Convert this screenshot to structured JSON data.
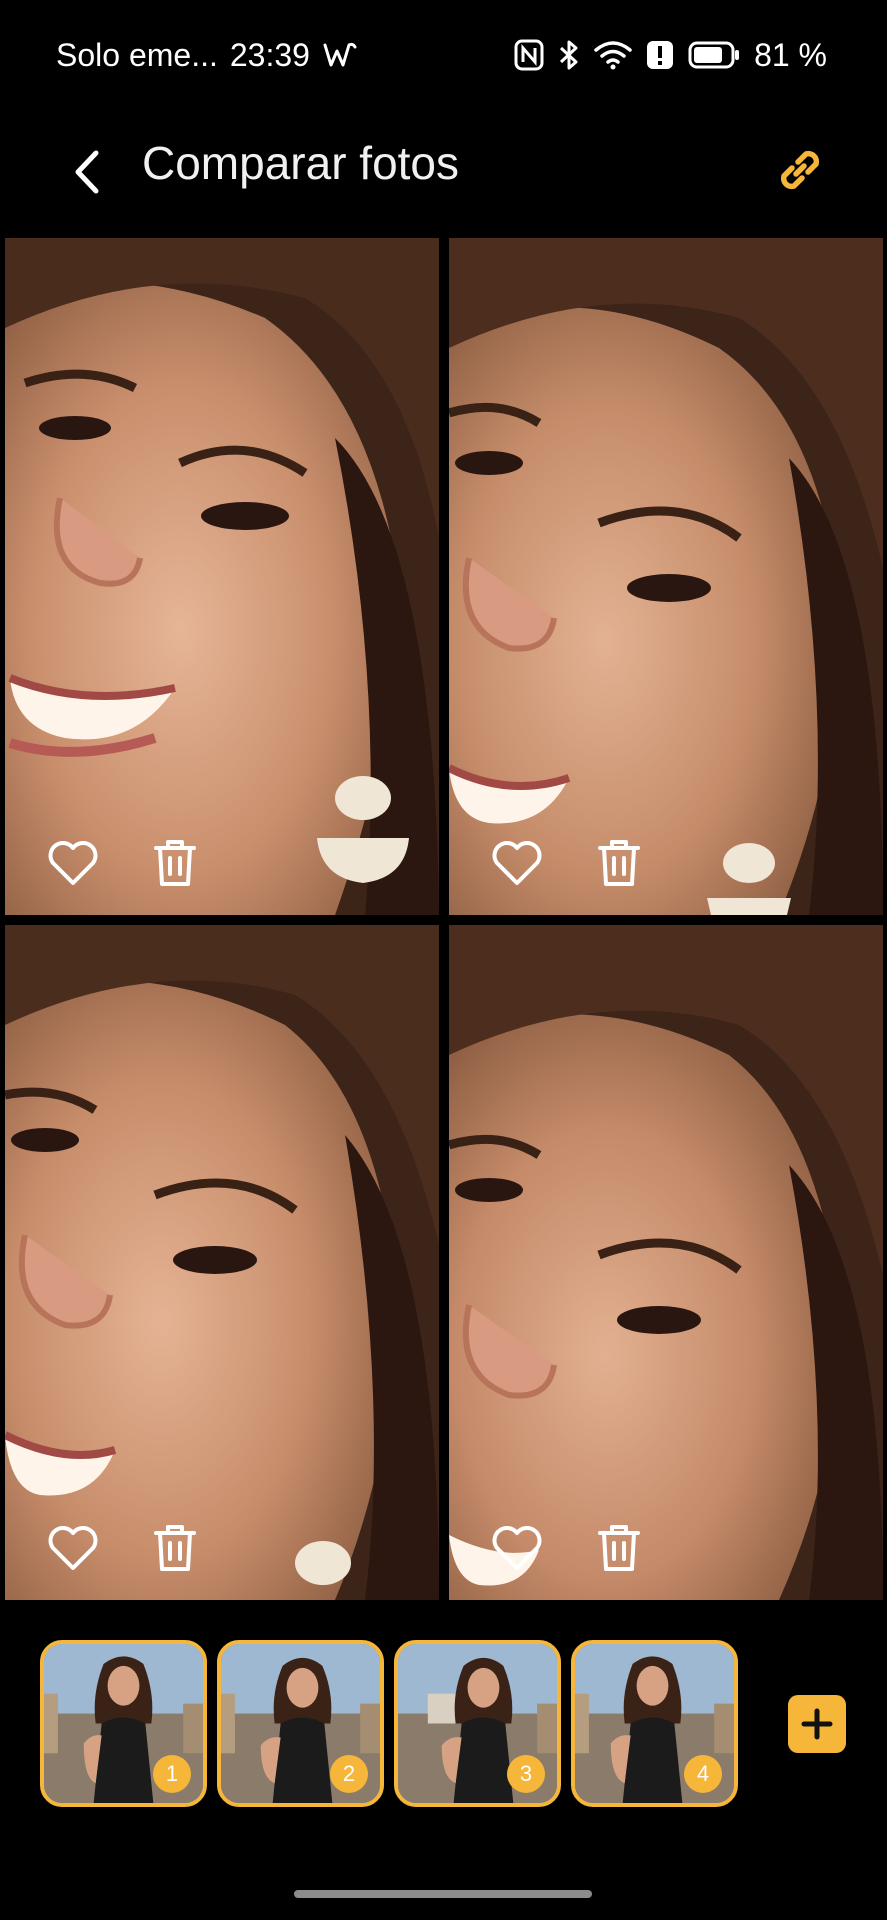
{
  "status_bar": {
    "carrier": "Solo eme...",
    "time": "23:39",
    "battery": "81 %",
    "icons": [
      "signal-wave-icon",
      "nfc-icon",
      "bluetooth-icon",
      "wifi-icon",
      "alert-icon",
      "battery-icon"
    ]
  },
  "header": {
    "title": "Comparar fotos",
    "back_icon": "chevron-left-icon",
    "link_icon": "link-icon"
  },
  "photos": [
    {
      "index": 1,
      "favorite_icon": "heart-icon",
      "delete_icon": "trash-icon"
    },
    {
      "index": 2,
      "favorite_icon": "heart-icon",
      "delete_icon": "trash-icon"
    },
    {
      "index": 3,
      "favorite_icon": "heart-icon",
      "delete_icon": "trash-icon"
    },
    {
      "index": 4,
      "favorite_icon": "heart-icon",
      "delete_icon": "trash-icon"
    }
  ],
  "thumbnails": [
    {
      "number": "1"
    },
    {
      "number": "2"
    },
    {
      "number": "3"
    },
    {
      "number": "4"
    }
  ],
  "add_icon": "plus-icon",
  "colors": {
    "accent": "#f5b63a",
    "background": "#000000",
    "text": "#ffffff"
  }
}
